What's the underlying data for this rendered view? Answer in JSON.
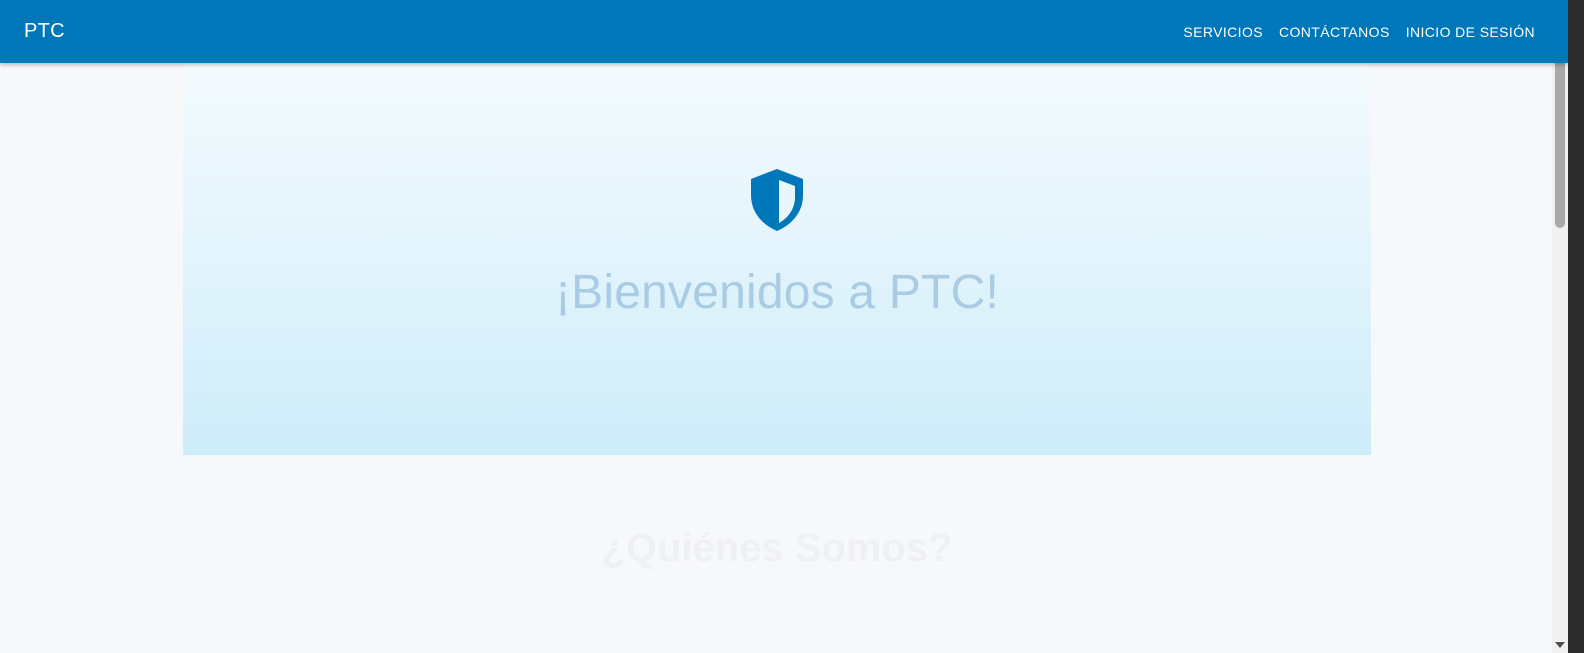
{
  "appbar": {
    "brand": "PTC",
    "nav": [
      {
        "label": "SERVICIOS"
      },
      {
        "label": "CONTÁCTANOS"
      },
      {
        "label": "INICIO DE SESIÓN"
      }
    ],
    "color": "#0077b9"
  },
  "hero": {
    "icon": "shield-icon",
    "title": "¡Bienvenidos a PTC!"
  },
  "about": {
    "title": "¿Quiénes Somos?"
  }
}
